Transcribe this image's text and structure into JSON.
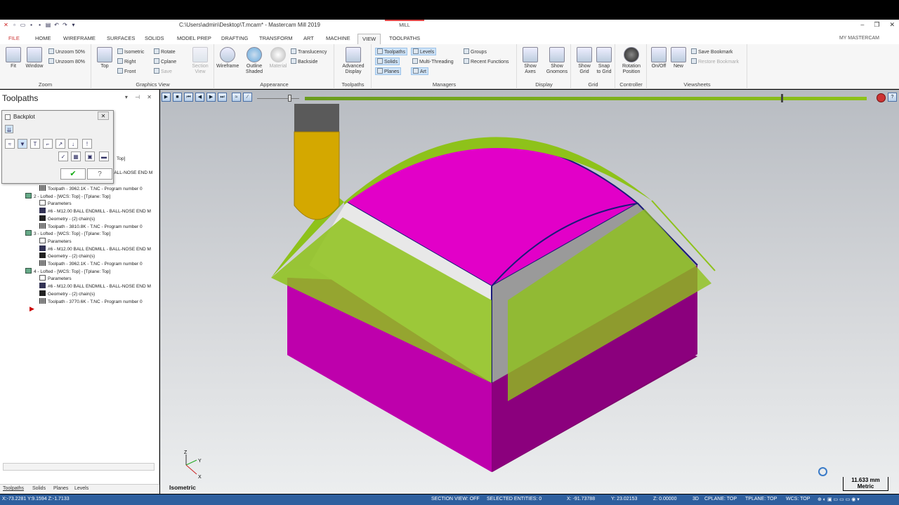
{
  "window": {
    "title": "C:\\Users\\admin\\Desktop\\T.mcam* - Mastercam Mill 2019",
    "context_tab": "MILL",
    "controls": [
      "–",
      "❐",
      "✕"
    ]
  },
  "ribbon_tabs": [
    "FILE",
    "HOME",
    "WIREFRAME",
    "SURFACES",
    "SOLIDS",
    "MODEL PREP",
    "DRAFTING",
    "TRANSFORM",
    "ART",
    "MACHINE",
    "VIEW",
    "TOOLPATHS"
  ],
  "active_tab": "VIEW",
  "my_mastercam": "MY MASTERCAM",
  "ribbon": {
    "zoom": {
      "title": "Zoom",
      "fit": "Fit",
      "window": "Window",
      "unzoom50": "Unzoom 50%",
      "unzoom80": "Unzoom 80%"
    },
    "graphics_view": {
      "title": "Graphics View",
      "top": "Top",
      "isometric": "Isometric",
      "right": "Right",
      "front": "Front",
      "rotate": "Rotate",
      "cplane": "Cplane",
      "save": "Save",
      "section_view_1": "Section",
      "section_view_2": "View"
    },
    "appearance": {
      "title": "Appearance",
      "wireframe": "Wireframe",
      "outline_1": "Outline",
      "outline_2": "Shaded",
      "material": "Material",
      "translucency": "Translucency",
      "backside": "Backside"
    },
    "toolpaths_group": {
      "title": "Toolpaths",
      "advanced_1": "Advanced",
      "advanced_2": "Display"
    },
    "managers": {
      "title": "Managers",
      "toolpaths": "Toolpaths",
      "levels": "Levels",
      "groups": "Groups",
      "solids": "Solids",
      "multithreading": "Multi-Threading",
      "recent_functions": "Recent Functions",
      "planes": "Planes",
      "art": "Art"
    },
    "display": {
      "title": "Display",
      "show_axes_1": "Show",
      "show_axes_2": "Axes",
      "show_gnomons_1": "Show",
      "show_gnomons_2": "Gnomons"
    },
    "grid": {
      "title": "Grid",
      "show_grid_1": "Show",
      "show_grid_2": "Grid",
      "snap_1": "Snap",
      "snap_2": "to Grid"
    },
    "controller": {
      "title": "Controller",
      "rotation_1": "Rotation",
      "rotation_2": "Position"
    },
    "viewsheets": {
      "title": "Viewsheets",
      "onoff": "On/Off",
      "new": "New",
      "save_bookmark": "Save Bookmark",
      "restore_bookmark": "Restore Bookmark"
    }
  },
  "panel": {
    "title": "Toolpaths",
    "tree": [
      {
        "text": "Toolpath - 3962.1K - T.NC - Program number 0",
        "icon": "tp",
        "indent": 2
      },
      {
        "text": "2 - Lofted - [WCS: Top] - [Tplane: Top]",
        "icon": "op",
        "indent": 1
      },
      {
        "text": "Parameters",
        "icon": "folder",
        "indent": 2
      },
      {
        "text": "#6 - M12.00 BALL ENDMILL - BALL-NOSE END M",
        "icon": "tool",
        "indent": 2
      },
      {
        "text": "Geometry - (2) chain(s)",
        "icon": "geo",
        "indent": 2
      },
      {
        "text": "Toolpath - 3810.8K - T.NC - Program number 0",
        "icon": "tp",
        "indent": 2
      },
      {
        "text": "3 - Lofted - [WCS: Top] - [Tplane: Top]",
        "icon": "op",
        "indent": 1
      },
      {
        "text": "Parameters",
        "icon": "folder",
        "indent": 2
      },
      {
        "text": "#6 - M12.00 BALL ENDMILL - BALL-NOSE END M",
        "icon": "tool",
        "indent": 2
      },
      {
        "text": "Geometry - (2) chain(s)",
        "icon": "geo",
        "indent": 2
      },
      {
        "text": "Toolpath - 3962.1K - T.NC - Program number 0",
        "icon": "tp",
        "indent": 2
      },
      {
        "text": "4 - Lofted - [WCS: Top] - [Tplane: Top]",
        "icon": "op",
        "indent": 1
      },
      {
        "text": "Parameters",
        "icon": "folder",
        "indent": 2
      },
      {
        "text": "#6 - M12.00 BALL ENDMILL - BALL-NOSE END M",
        "icon": "tool",
        "indent": 2
      },
      {
        "text": "Geometry - (2) chain(s)",
        "icon": "geo",
        "indent": 2
      },
      {
        "text": "Toolpath - 3770.6K - T.NC - Program number 0",
        "icon": "tp",
        "indent": 2
      }
    ],
    "partial_rows": {
      "top": "Top]",
      "end": "BALL-NOSE END M"
    },
    "bottom_tabs": [
      "Toolpaths",
      "Solids",
      "Planes",
      "Levels"
    ]
  },
  "backplot": {
    "title": "Backplot",
    "close": "✕"
  },
  "viewport": {
    "view_name": "Isometric",
    "scale_value": "11.633 mm",
    "scale_unit": "Metric",
    "gnomon": {
      "z": "Z",
      "y": "Y",
      "x": "X"
    },
    "colors": {
      "part_top": "#e000c8",
      "part_side": "#b0009e",
      "toolpath": "#8ec21a",
      "tool": "#d4a800"
    }
  },
  "status": {
    "coords": "X:-73.2281   Y:9.1594   Z:-1.7133",
    "section_view": "SECTION VIEW: OFF",
    "selected": "SELECTED ENTITIES: 0",
    "x": "X:   -91.73788",
    "y": "Y:   23.02153",
    "z": "Z:   0.00000",
    "mode": "3D",
    "cplane": "CPLANE: TOP",
    "tplane": "TPLANE: TOP",
    "wcs": "WCS: TOP"
  }
}
